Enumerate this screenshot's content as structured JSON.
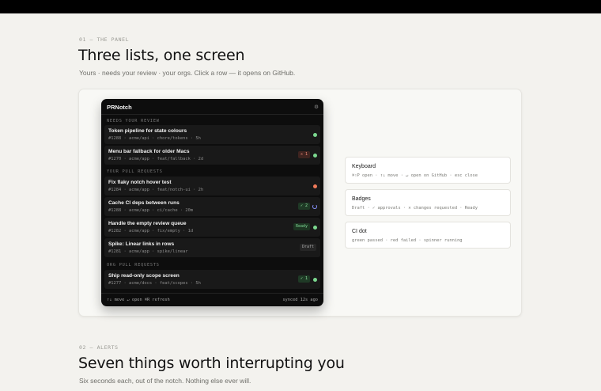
{
  "section1": {
    "eyebrow": "01 — THE PANEL",
    "title": "Three lists, one screen",
    "subtitle": "Yours · needs your review · your orgs. Click a row — it opens on GitHub."
  },
  "panel": {
    "title": "PRNotch",
    "settings_icon": "gear-icon",
    "sections": [
      {
        "label": "NEEDS YOUR REVIEW",
        "rows": [
          {
            "title": "Token pipeline for state colours",
            "meta": "#1288 · acme/api · chore/tokens · 5h",
            "badge": "",
            "status": "green"
          },
          {
            "title": "Menu bar fallback for older Macs",
            "meta": "#1270 · acme/app · feat/fallback · 2d",
            "badge": "✕ 1",
            "status": "green"
          }
        ]
      },
      {
        "label": "YOUR PULL REQUESTS",
        "rows": [
          {
            "title": "Fix flaky notch hover test",
            "meta": "#1284 · acme/app · feat/notch-ui · 2h",
            "badge": "",
            "status": "red"
          },
          {
            "title": "Cache CI deps between runs",
            "meta": "#1288 · acme/app · ci/cache · 20m",
            "badge": "✓ 2",
            "status": "running"
          },
          {
            "title": "Handle the empty review queue",
            "meta": "#1282 · acme/app · fix/empty · 1d",
            "badge": "Ready",
            "status": "green"
          },
          {
            "title": "Spike: Linear links in rows",
            "meta": "#1281 · acme/app · spike/linear",
            "badge": "Draft",
            "status": ""
          }
        ]
      },
      {
        "label": "ORG PULL REQUESTS",
        "rows": [
          {
            "title": "Ship read-only scope screen",
            "meta": "#1277 · acme/docs · feat/scopes · 5h",
            "badge": "✓ 1",
            "status": "green"
          }
        ]
      }
    ],
    "footer_left": "↑↓ move   ↵ open   ⌘R refresh",
    "footer_right": "synced 12s ago"
  },
  "cards": [
    {
      "title": "Keyboard",
      "body": "⌘⇧P open · ↑↓ move · ↵ open on GitHub · esc close"
    },
    {
      "title": "Badges",
      "body": "Draft · ✓ approvals · ✕ changes requested · Ready"
    },
    {
      "title": "CI dot",
      "body": "green passed · red failed · spinner running"
    }
  ],
  "section2": {
    "eyebrow": "02 — ALERTS",
    "title": "Seven things worth interrupting you",
    "subtitle": "Six seconds each, out of the notch. Nothing else ever will."
  },
  "colors": {
    "green": "#7bd88f",
    "red": "#f07a5a",
    "spinner": "#8a93ff",
    "approve_bg": "#1f3a26",
    "approve_fg": "#8fe0a0",
    "changes_bg": "#3f2420",
    "changes_fg": "#f08a78",
    "ready_bg": "#1d3522",
    "ready_fg": "#7fd695",
    "draft_bg": "#262626",
    "draft_fg": "#a9a9a9"
  }
}
